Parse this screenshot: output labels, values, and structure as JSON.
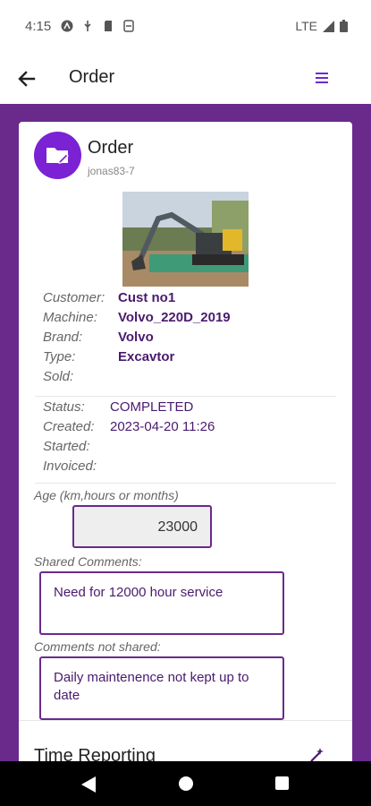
{
  "status_bar": {
    "time": "4:15",
    "network": "LTE"
  },
  "app_bar": {
    "title": "Order",
    "icons": [
      "back-arrow-icon",
      "menu-icon"
    ]
  },
  "order_card": {
    "title": "Order",
    "subtitle": "jonas83-7",
    "icon": "folder-edit-icon",
    "machine_image": "excavator-photo",
    "machine_info": [
      {
        "key": "Customer:",
        "value": "Cust no1"
      },
      {
        "key": "Machine:",
        "value": "Volvo_220D_2019"
      },
      {
        "key": "Brand:",
        "value": "Volvo"
      },
      {
        "key": "Type:",
        "value": "Excavtor"
      },
      {
        "key": "Sold:",
        "value": ""
      }
    ],
    "status_info": [
      {
        "key": "Status:",
        "value": "COMPLETED"
      },
      {
        "key": "Created:",
        "value": "2023-04-20 11:26"
      },
      {
        "key": "Started:",
        "value": ""
      },
      {
        "key": "Invoiced:",
        "value": ""
      }
    ],
    "age_label": "Age (km,hours or months)",
    "age_value": "23000",
    "shared_comments_label": "Shared Comments:",
    "shared_comments_value": "Need for 12000 hour service",
    "private_comments_label": "Comments not shared:",
    "private_comments_value": "Daily maintenence not kept up to date",
    "time_reporting_title": "Time Reporting"
  },
  "colors": {
    "accent": "#6a2a8c",
    "avatar": "#7b22d4",
    "value_text": "#4a1a6e"
  }
}
